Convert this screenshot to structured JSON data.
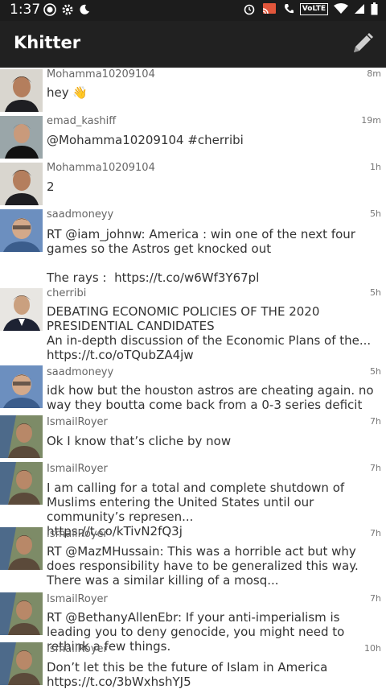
{
  "status": {
    "time": "1:37",
    "network_badge": "VoLTE"
  },
  "app": {
    "title": "Khitter"
  },
  "tweets": [
    {
      "user": "Mohamma10209104",
      "time": "8m",
      "text": "hey 👋"
    },
    {
      "user": "emad_kashiff",
      "time": "19m",
      "text": "@Mohamma10209104 #cherribi"
    },
    {
      "user": "Mohamma10209104",
      "time": "1h",
      "text": "2"
    },
    {
      "user": "saadmoneyy",
      "time": "5h",
      "text": "RT @iam_johnw: America : win one of the next four games so the Astros get knocked out\n\nThe rays :  https://t.co/w6Wf3Y67pl"
    },
    {
      "user": "cherribi",
      "time": "5h",
      "text": "DEBATING ECONOMIC POLICIES OF THE 2020 PRESIDENTIAL CANDIDATES\nAn in-depth discussion of the Economic Plans of the...\nhttps://t.co/oTQubZA4jw"
    },
    {
      "user": "saadmoneyy",
      "time": "5h",
      "text": "idk how but the houston astros are cheating again. no way they boutta come back from a 0-3 series deficit"
    },
    {
      "user": "IsmailRoyer",
      "time": "7h",
      "text": "Ok I know that’s cliche by now"
    },
    {
      "user": "IsmailRoyer",
      "time": "7h",
      "text": "I am calling for a total and complete shutdown of Muslims entering the United States until our community’s represen...\nhttps://t.co/kTivN2fQ3j"
    },
    {
      "user": "IsmailRoyer",
      "time": "7h",
      "text": "RT @MazMHussain: This was a horrible act but why does responsibility have to be generalized this way. There was a similar killing of a mosq..."
    },
    {
      "user": "IsmailRoyer",
      "time": "7h",
      "text": "RT @BethanyAllenEbr: If your anti-imperialism is leading you to deny genocide, you might need to rethink a few things."
    },
    {
      "user": "IsmailRoyer",
      "time": "10h",
      "text": "Don’t let this be the future of Islam in America\nhttps://t.co/3bWxhshYJ5"
    }
  ]
}
